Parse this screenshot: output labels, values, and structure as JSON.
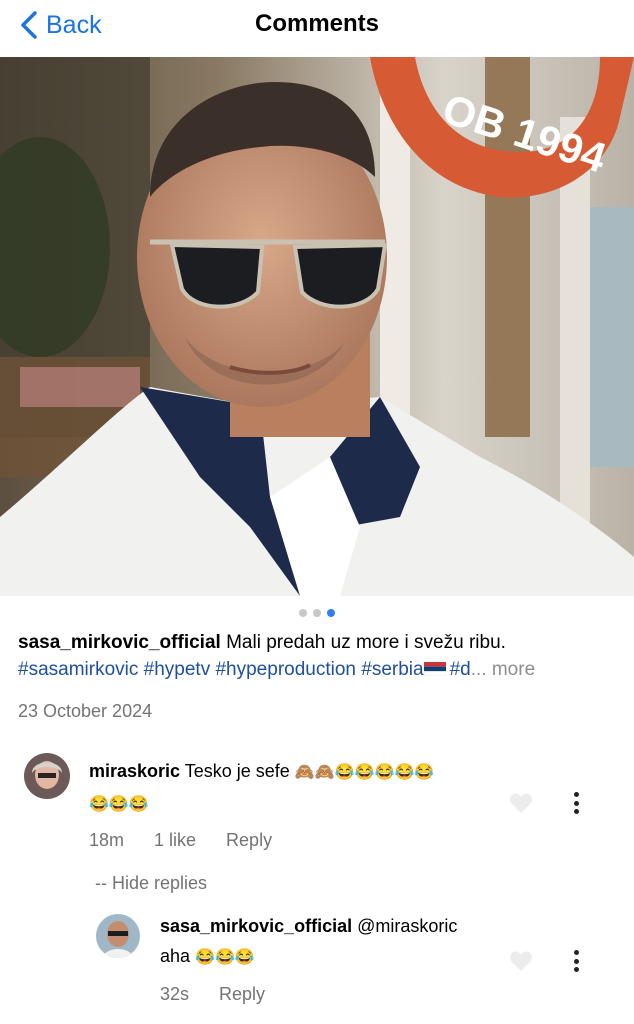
{
  "header": {
    "back_label": "Back",
    "title": "Comments"
  },
  "photo": {
    "lifebuoy_text": "OB 1994",
    "carousel_total": 3,
    "carousel_active": 3
  },
  "caption": {
    "username": "sasa_mirkovic_official",
    "text": "Mali predah uz more i svežu ribu.",
    "hashtags": [
      "#sasamirkovic",
      "#hypetv",
      "#hypeproduction",
      "#serbia"
    ],
    "truncated_tag": "#d",
    "more_label": "... more",
    "date": "23 October 2024"
  },
  "comments": [
    {
      "username": "miraskoric",
      "text": "Tesko je sefe",
      "emojis_line1": "🙈🙈😂😂😂😂😂",
      "emojis_line2": "😂😂😂",
      "time": "18m",
      "likes": "1 like",
      "reply_label": "Reply"
    }
  ],
  "hide_replies_label": "-- Hide replies",
  "replies": [
    {
      "username": "sasa_mirkovic_official",
      "mention": "@miraskoric",
      "text": "aha",
      "emojis": "😂😂😂",
      "time": "32s",
      "reply_label": "Reply"
    }
  ],
  "colors": {
    "accent": "#1a73e8",
    "hashtag": "#1e4fa0",
    "muted": "#737373"
  }
}
